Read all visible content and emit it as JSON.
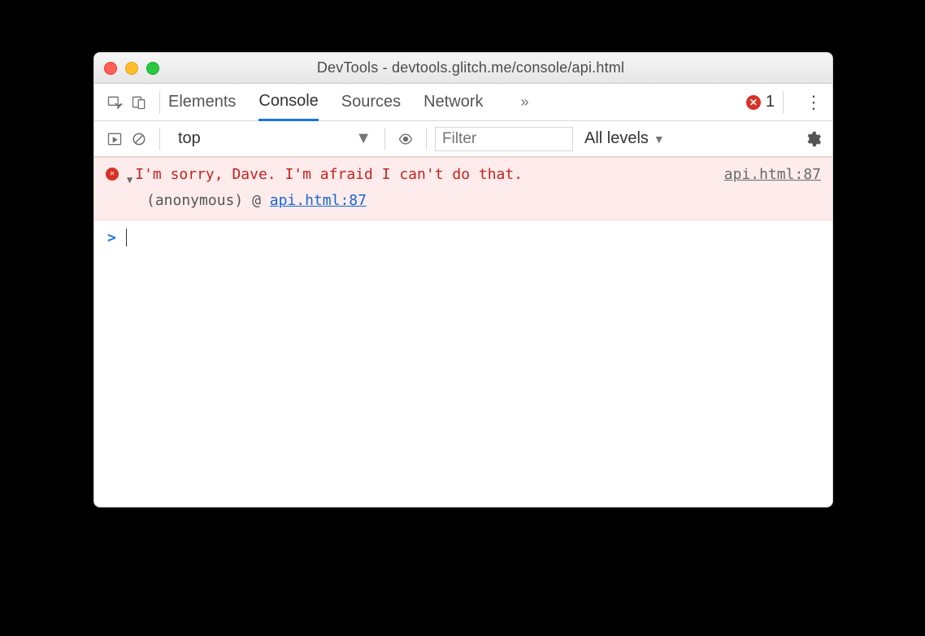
{
  "window": {
    "title": "DevTools - devtools.glitch.me/console/api.html"
  },
  "tabs": {
    "items": [
      "Elements",
      "Console",
      "Sources",
      "Network"
    ],
    "active_index": 1,
    "overflow_glyph": "»"
  },
  "error_counter": {
    "count": "1"
  },
  "toolbar": {
    "context": "top",
    "filter_placeholder": "Filter",
    "levels_label": "All levels"
  },
  "console": {
    "error": {
      "message": "I'm sorry, Dave. I'm afraid I can't do that.",
      "source": "api.html:87",
      "stack_func": "(anonymous)",
      "stack_sep": "@",
      "stack_link": "api.html:87"
    },
    "prompt_glyph": ">"
  }
}
